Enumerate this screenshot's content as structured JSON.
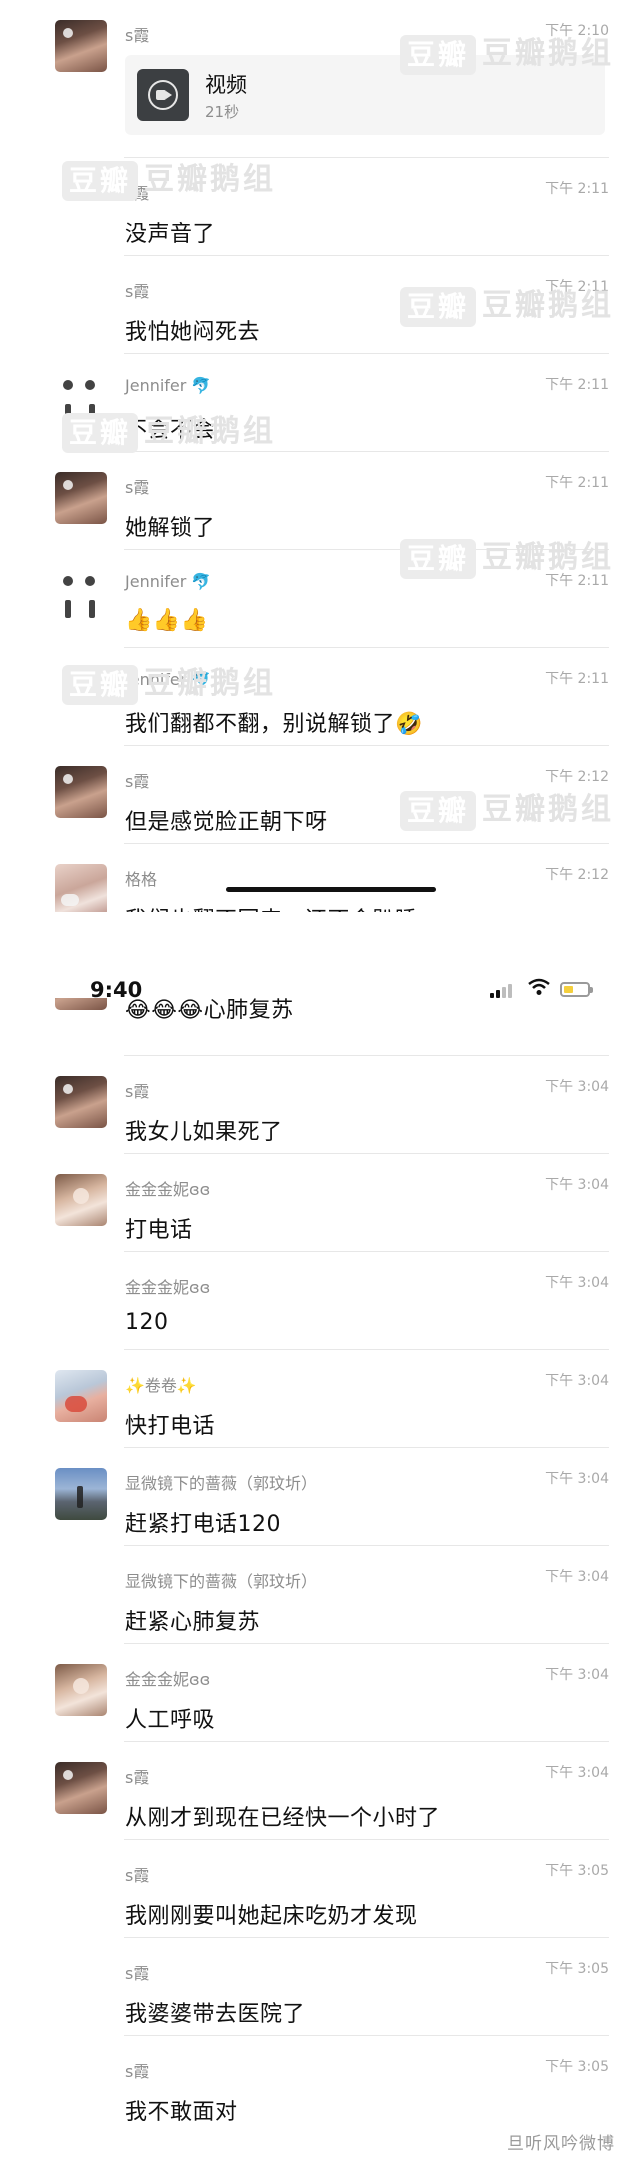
{
  "top_panel": {
    "messages": [
      {
        "sender": "s霞",
        "time": "下午 2:10",
        "video": {
          "title": "视频",
          "duration": "21秒"
        }
      },
      {
        "sender": "s霞",
        "time": "下午 2:11",
        "text": "没声音了"
      },
      {
        "sender": "s霞",
        "time": "下午 2:11",
        "text": "我怕她闷死去"
      },
      {
        "sender": "Jennifer 🐬",
        "time": "下午 2:11",
        "text": "不会不会"
      },
      {
        "sender": "s霞",
        "time": "下午 2:11",
        "text": "她解锁了"
      },
      {
        "sender": "Jennifer 🐬",
        "time": "下午 2:11",
        "text": "👍👍👍"
      },
      {
        "sender": "Jennifer 🐬",
        "time": "下午 2:11",
        "text": "我们翻都不翻，别说解锁了🤣"
      },
      {
        "sender": "s霞",
        "time": "下午 2:12",
        "text": "但是感觉脸正朝下呀"
      },
      {
        "sender": "格格",
        "time": "下午 2:12",
        "text": "我们也翻不回来，还不会趴睡"
      }
    ],
    "watermark": {
      "box": "豆瓣",
      "label": "豆瓣鹅组"
    }
  },
  "bottom_panel": {
    "status_bar": {
      "time": "9:40"
    },
    "partial_text": "😂😂😂心肺复苏",
    "messages": [
      {
        "sender": "s霞",
        "time": "下午 3:04",
        "text": "我女儿如果死了"
      },
      {
        "sender": "金金金妮ɞɞ",
        "time": "下午 3:04",
        "text": "打电话"
      },
      {
        "sender": "金金金妮ɞɞ",
        "time": "下午 3:04",
        "text": "120"
      },
      {
        "sender": "✨卷卷✨",
        "time": "下午 3:04",
        "text": "快打电话"
      },
      {
        "sender": "显微镜下的蔷薇（郭玟圻）",
        "time": "下午 3:04",
        "text": "赶紧打电话120"
      },
      {
        "sender": "显微镜下的蔷薇（郭玟圻）",
        "time": "下午 3:04",
        "text": "赶紧心肺复苏"
      },
      {
        "sender": "金金金妮ɞɞ",
        "time": "下午 3:04",
        "text": "人工呼吸"
      },
      {
        "sender": "s霞",
        "time": "下午 3:04",
        "text": "从刚才到现在已经快一个小时了"
      },
      {
        "sender": "s霞",
        "time": "下午 3:05",
        "text": "我刚刚要叫她起床吃奶才发现"
      },
      {
        "sender": "s霞",
        "time": "下午 3:05",
        "text": "我婆婆带去医院了"
      },
      {
        "sender": "s霞",
        "time": "下午 3:05",
        "text": "我不敢面对"
      }
    ]
  },
  "footer_watermark": "旦听风吟微博",
  "colors": {
    "background": "#ffffff",
    "meta_text": "#8d8d8d",
    "time_text": "#a9a9a9",
    "battery": "#f4cf3d"
  }
}
